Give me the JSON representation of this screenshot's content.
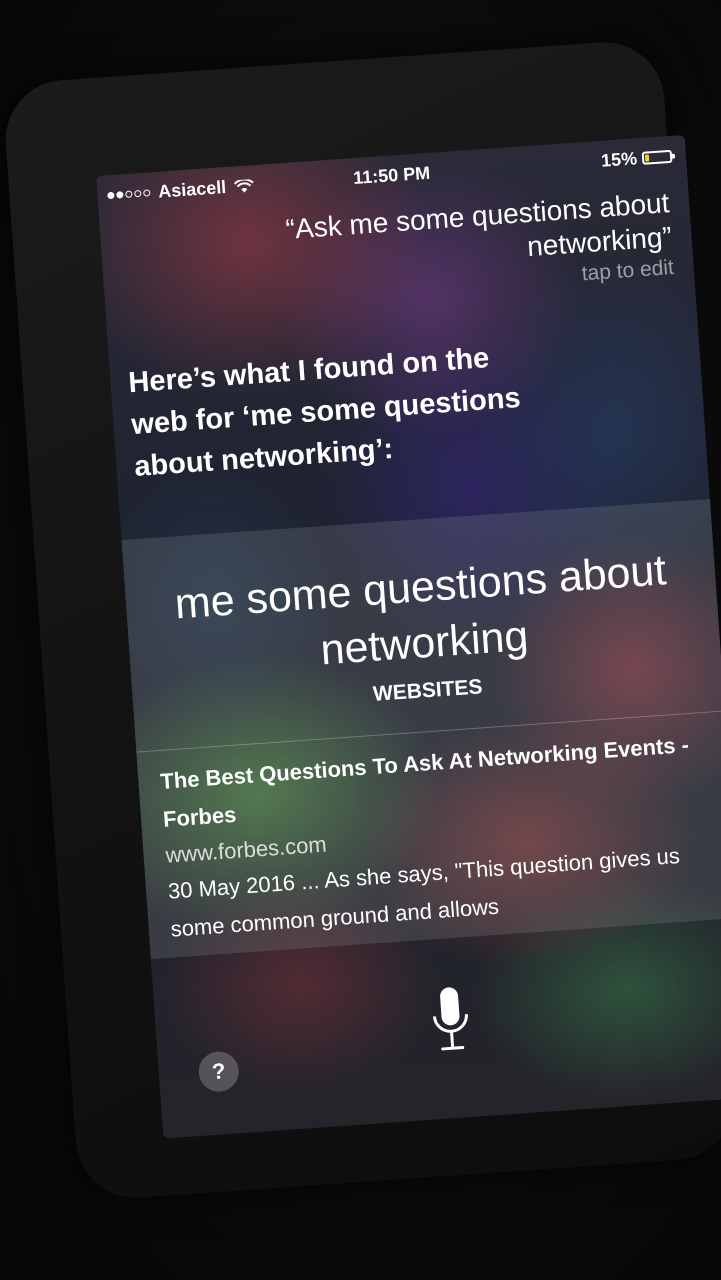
{
  "status_bar": {
    "carrier": "Asiacell",
    "signal_strength": 2,
    "signal_max": 5,
    "time": "11:50 PM",
    "battery_percent": "15%",
    "battery_level": 0.15,
    "battery_color": "#f2d21e"
  },
  "query": {
    "text": "“Ask me some questions about networking”",
    "edit_hint": "tap to edit"
  },
  "response": {
    "text": "Here’s what I found on the web for ‘me some questions about networking’:"
  },
  "web_card": {
    "heading": "me some questions about networking",
    "category": "WEBSITES",
    "results": [
      {
        "title": "The Best Questions To Ask At Networking Events - Forbes",
        "url": "www.forbes.com",
        "snippet": "30 May 2016 ... As she says, \"This question gives us some common ground and allows"
      }
    ]
  },
  "controls": {
    "help_label": "?",
    "mic_icon": "microphone-icon"
  }
}
